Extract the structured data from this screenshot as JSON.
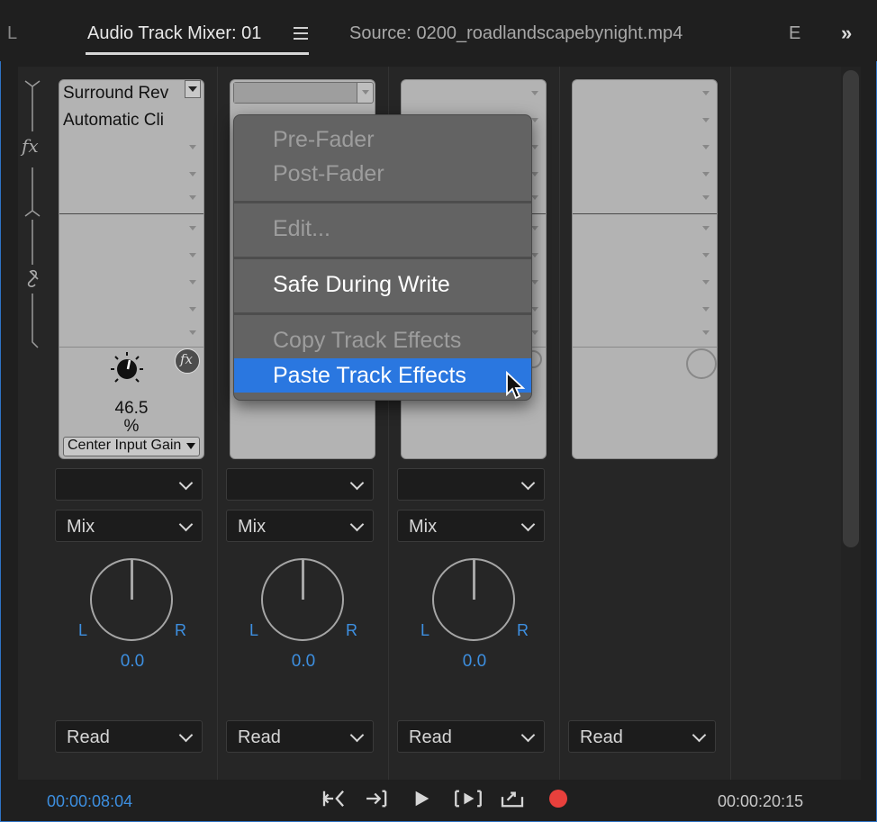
{
  "header": {
    "left_partial_tab": "L",
    "active_tab": "Audio Track Mixer: 01",
    "source_tab": "Source: 0200_roadlandscapebynight.mp4",
    "right_partial_tab": "E",
    "overflow": "»"
  },
  "side_strip": {
    "fx_label": "fx"
  },
  "tracks": [
    {
      "fx_slot_1": "Surround Rev",
      "fx_slot_2": "Automatic Cli",
      "gain_value": "46.5",
      "gain_unit": "%",
      "param_name": "Center Input Gain",
      "input": "",
      "send": "Mix",
      "pan_left": "L",
      "pan_right": "R",
      "pan_value": "0.0",
      "automation": "Read"
    },
    {
      "input": "",
      "send": "Mix",
      "pan_left": "L",
      "pan_right": "R",
      "pan_value": "0.0",
      "automation": "Read"
    },
    {
      "input": "",
      "send": "Mix",
      "pan_left": "L",
      "pan_right": "R",
      "pan_value": "0.0",
      "automation": "Read"
    },
    {
      "automation": "Read"
    }
  ],
  "context_menu": {
    "items": [
      {
        "label": "Pre-Fader",
        "state": "disabled"
      },
      {
        "label": "Post-Fader",
        "state": "disabled"
      },
      {
        "label": "Edit...",
        "state": "disabled"
      },
      {
        "label": "Safe During Write",
        "state": "enabled"
      },
      {
        "label": "Copy Track Effects",
        "state": "disabled"
      },
      {
        "label": "Paste Track Effects",
        "state": "highlighted"
      }
    ]
  },
  "footer": {
    "current_time": "00:00:08:04",
    "duration": "00:00:20:15"
  },
  "colors": {
    "accent_blue": "#3d8fe0",
    "highlight": "#2a77e0",
    "record": "#e8403c",
    "panel_border": "#2f73c4"
  },
  "icons": {
    "transport": [
      "go-to-in-icon",
      "go-to-out-icon",
      "play-icon",
      "play-in-to-out-icon",
      "loop-icon",
      "record-icon"
    ]
  }
}
